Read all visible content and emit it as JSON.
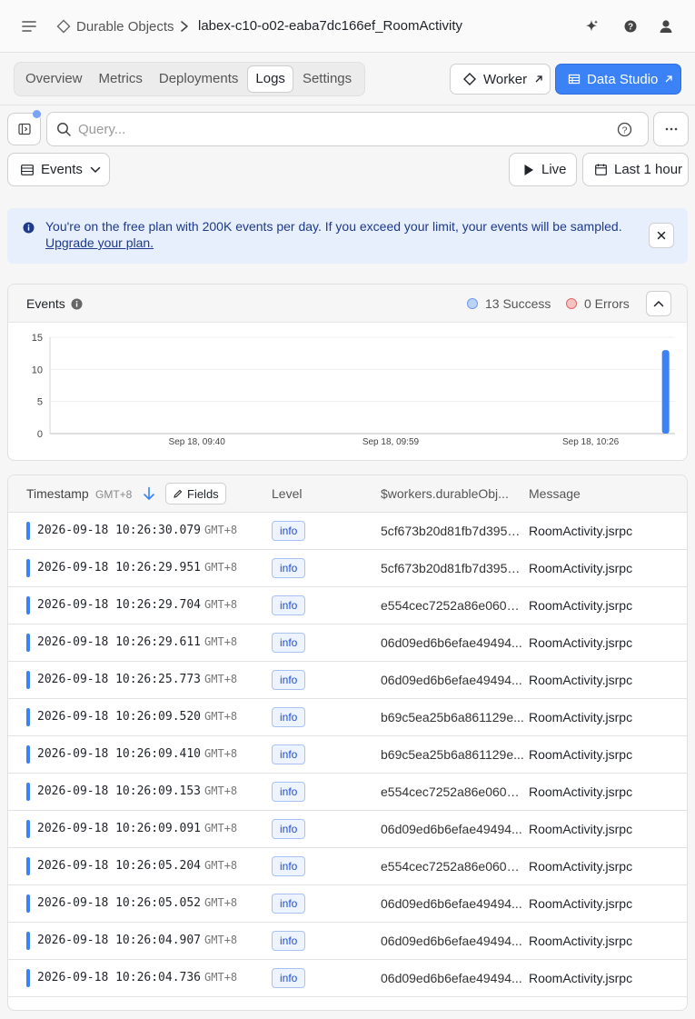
{
  "header": {
    "menu_icon": "menu-icon",
    "breadcrumb_parent": "Durable Objects",
    "breadcrumb_parent_icon": "durable-objects-icon",
    "breadcrumb_current": "labex-c10-o02-eaba7dc166ef_RoomActivity",
    "icons": [
      "sparkle-icon",
      "help-icon",
      "user-icon"
    ]
  },
  "tabs": [
    {
      "label": "Overview",
      "active": false
    },
    {
      "label": "Metrics",
      "active": false
    },
    {
      "label": "Deployments",
      "active": false
    },
    {
      "label": "Logs",
      "active": true
    },
    {
      "label": "Settings",
      "active": false
    }
  ],
  "actions": {
    "worker_label": "Worker",
    "studio_label": "Data Studio",
    "accent": "#3b82f6"
  },
  "query": {
    "placeholder": "Query...",
    "value": ""
  },
  "controls": {
    "view_label": "Events",
    "live_label": "Live",
    "time_range_label": "Last 1 hour"
  },
  "banner": {
    "text": "You're on the free plan with 200K events per day. If you exceed your limit, your events will be sampled.",
    "link": "Upgrade your plan."
  },
  "events_panel": {
    "title": "Events",
    "success_legend": "13 Success",
    "errors_legend": "0 Errors",
    "success_color": "#3b82f6",
    "error_color": "#ef4444"
  },
  "chart_data": {
    "type": "bar",
    "title": "",
    "xlabel": "",
    "ylabel": "",
    "ylim": [
      0,
      15
    ],
    "yticks": [
      0,
      5,
      10,
      15
    ],
    "xticks": [
      "Sep 18, 09:40",
      "Sep 18, 09:59",
      "Sep 18, 10:26"
    ],
    "grid": true,
    "series": [
      {
        "name": "Success",
        "values": [
          {
            "x": "Sep 18, 10:26",
            "y": 13
          }
        ]
      }
    ]
  },
  "table": {
    "columns": {
      "timestamp": "Timestamp",
      "timezone": "GMT+8",
      "fields_button": "Fields",
      "level": "Level",
      "durable_object": "$workers.durableObj...",
      "message": "Message"
    },
    "rows": [
      {
        "timestamp": "2026-09-18 10:26:30.079",
        "tz": "GMT+8",
        "level": "info",
        "id": "5cf673b20d81fb7d3954...",
        "message": "RoomActivity.jsrpc"
      },
      {
        "timestamp": "2026-09-18 10:26:29.951",
        "tz": "GMT+8",
        "level": "info",
        "id": "5cf673b20d81fb7d3954...",
        "message": "RoomActivity.jsrpc"
      },
      {
        "timestamp": "2026-09-18 10:26:29.704",
        "tz": "GMT+8",
        "level": "info",
        "id": "e554cec7252a86e060a...",
        "message": "RoomActivity.jsrpc"
      },
      {
        "timestamp": "2026-09-18 10:26:29.611",
        "tz": "GMT+8",
        "level": "info",
        "id": "06d09ed6b6efae49494...",
        "message": "RoomActivity.jsrpc"
      },
      {
        "timestamp": "2026-09-18 10:26:25.773",
        "tz": "GMT+8",
        "level": "info",
        "id": "06d09ed6b6efae49494...",
        "message": "RoomActivity.jsrpc"
      },
      {
        "timestamp": "2026-09-18 10:26:09.520",
        "tz": "GMT+8",
        "level": "info",
        "id": "b69c5ea25b6a861129e...",
        "message": "RoomActivity.jsrpc"
      },
      {
        "timestamp": "2026-09-18 10:26:09.410",
        "tz": "GMT+8",
        "level": "info",
        "id": "b69c5ea25b6a861129e...",
        "message": "RoomActivity.jsrpc"
      },
      {
        "timestamp": "2026-09-18 10:26:09.153",
        "tz": "GMT+8",
        "level": "info",
        "id": "e554cec7252a86e060a...",
        "message": "RoomActivity.jsrpc"
      },
      {
        "timestamp": "2026-09-18 10:26:09.091",
        "tz": "GMT+8",
        "level": "info",
        "id": "06d09ed6b6efae49494...",
        "message": "RoomActivity.jsrpc"
      },
      {
        "timestamp": "2026-09-18 10:26:05.204",
        "tz": "GMT+8",
        "level": "info",
        "id": "e554cec7252a86e060a...",
        "message": "RoomActivity.jsrpc"
      },
      {
        "timestamp": "2026-09-18 10:26:05.052",
        "tz": "GMT+8",
        "level": "info",
        "id": "06d09ed6b6efae49494...",
        "message": "RoomActivity.jsrpc"
      },
      {
        "timestamp": "2026-09-18 10:26:04.907",
        "tz": "GMT+8",
        "level": "info",
        "id": "06d09ed6b6efae49494...",
        "message": "RoomActivity.jsrpc"
      },
      {
        "timestamp": "2026-09-18 10:26:04.736",
        "tz": "GMT+8",
        "level": "info",
        "id": "06d09ed6b6efae49494...",
        "message": "RoomActivity.jsrpc"
      }
    ]
  }
}
